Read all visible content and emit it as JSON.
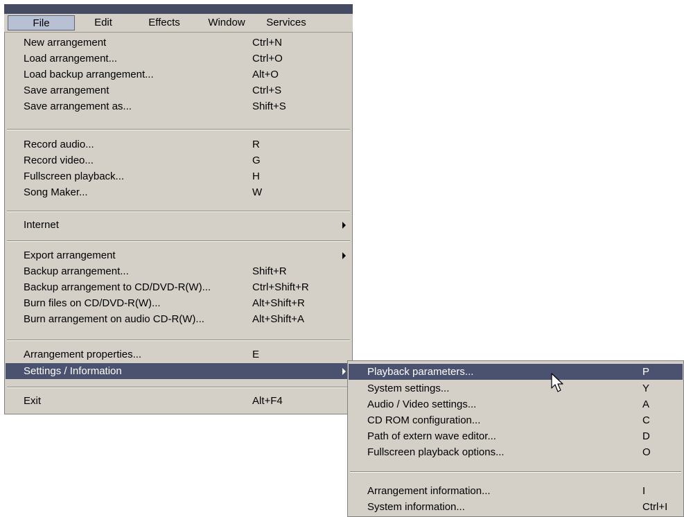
{
  "menubar": {
    "items": [
      "File",
      "Edit",
      "Effects",
      "Window",
      "Services"
    ]
  },
  "file_menu": {
    "items": [
      {
        "label": "New arrangement",
        "shortcut": "Ctrl+N"
      },
      {
        "label": "Load arrangement...",
        "shortcut": "Ctrl+O"
      },
      {
        "label": "Load backup arrangement...",
        "shortcut": "Alt+O"
      },
      {
        "label": "Save arrangement",
        "shortcut": "Ctrl+S"
      },
      {
        "label": "Save arrangement as...",
        "shortcut": "Shift+S"
      },
      {
        "label": "Record audio...",
        "shortcut": "R"
      },
      {
        "label": "Record video...",
        "shortcut": "G"
      },
      {
        "label": "Fullscreen playback...",
        "shortcut": "H"
      },
      {
        "label": "Song Maker...",
        "shortcut": "W"
      },
      {
        "label": "Internet",
        "shortcut": ""
      },
      {
        "label": "Export arrangement",
        "shortcut": ""
      },
      {
        "label": "Backup arrangement...",
        "shortcut": "Shift+R"
      },
      {
        "label": "Backup arrangement to CD/DVD-R(W)...",
        "shortcut": "Ctrl+Shift+R"
      },
      {
        "label": "Burn files on CD/DVD-R(W)...",
        "shortcut": "Alt+Shift+R"
      },
      {
        "label": "Burn arrangement on audio CD-R(W)...",
        "shortcut": "Alt+Shift+A"
      },
      {
        "label": "Arrangement properties...",
        "shortcut": "E"
      },
      {
        "label": "Settings / Information",
        "shortcut": ""
      },
      {
        "label": "Exit",
        "shortcut": "Alt+F4"
      }
    ]
  },
  "settings_submenu": {
    "items": [
      {
        "label": "Playback parameters...",
        "shortcut": "P"
      },
      {
        "label": "System settings...",
        "shortcut": "Y"
      },
      {
        "label": "Audio / Video settings...",
        "shortcut": "A"
      },
      {
        "label": "CD ROM configuration...",
        "shortcut": "C"
      },
      {
        "label": "Path of extern wave editor...",
        "shortcut": "D"
      },
      {
        "label": "Fullscreen playback options...",
        "shortcut": "O"
      },
      {
        "label": "Arrangement information...",
        "shortcut": "I"
      },
      {
        "label": "System information...",
        "shortcut": "Ctrl+I"
      }
    ]
  },
  "colors": {
    "menu_background": "#d4d0c8",
    "highlight": "#4a5270",
    "title_bar": "#444b63"
  },
  "icons": [
    "submenu-arrow-icon",
    "mouse-pointer-icon"
  ]
}
